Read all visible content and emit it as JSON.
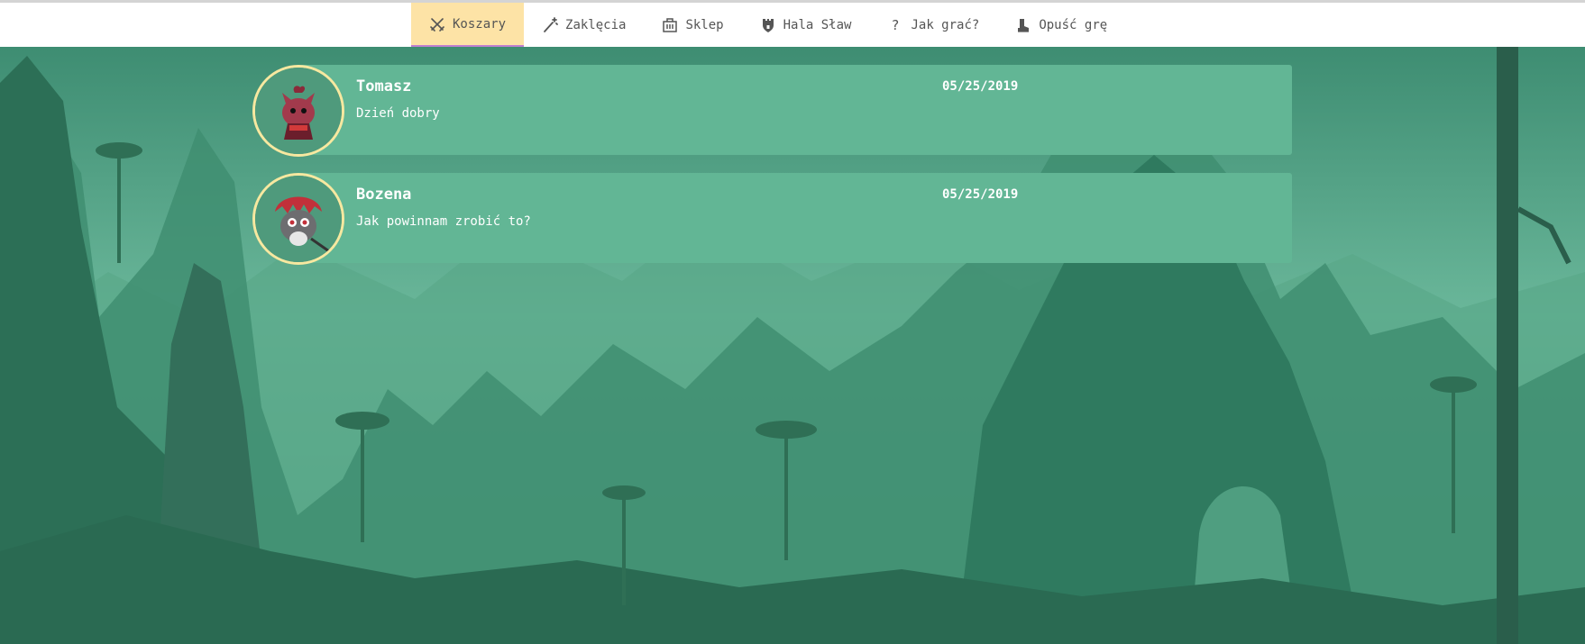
{
  "nav": {
    "items": [
      {
        "label": "Koszary",
        "icon": "crossed-swords-icon",
        "active": true
      },
      {
        "label": "Zaklęcia",
        "icon": "magic-wand-icon",
        "active": false
      },
      {
        "label": "Sklep",
        "icon": "shop-icon",
        "active": false
      },
      {
        "label": "Hala Sław",
        "icon": "castle-tower-icon",
        "active": false
      },
      {
        "label": "Jak grać?",
        "icon": "question-icon",
        "active": false
      },
      {
        "label": "Opuść grę",
        "icon": "exit-boot-icon",
        "active": false
      }
    ]
  },
  "messages": [
    {
      "author": "Tomasz",
      "date": "05/25/2019",
      "text": "Dzień dobry",
      "avatar": "red-fox-character-avatar"
    },
    {
      "author": "Bozena",
      "date": "05/25/2019",
      "text": "Jak powinnam zrobić to?",
      "avatar": "grey-mole-character-avatar"
    }
  ],
  "colors": {
    "nav_background": "#ffffff",
    "nav_active": "#fde3a6",
    "nav_active_underline": "#c07fd0",
    "card_background": "#62b695",
    "avatar_border": "#f7e8a0",
    "scene_tint": "#3f9a7a"
  }
}
